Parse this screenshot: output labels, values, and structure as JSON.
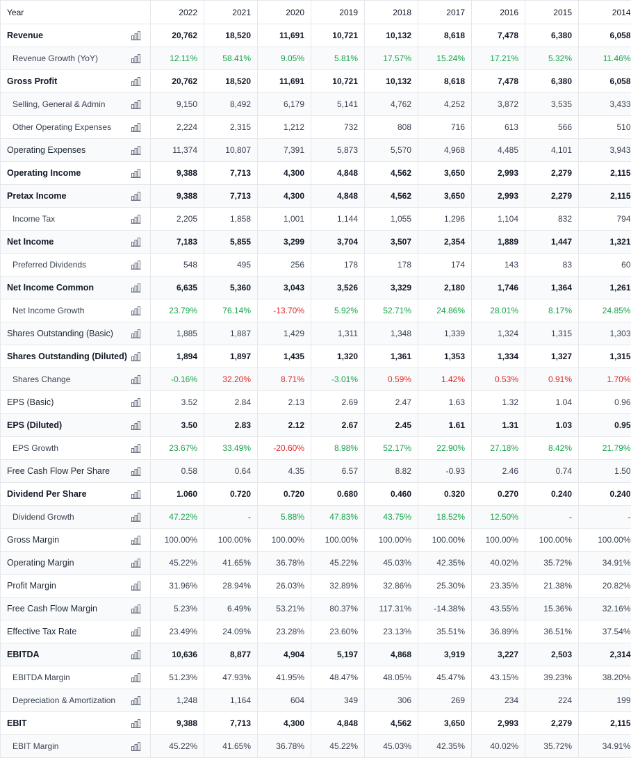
{
  "header": {
    "label": "Year",
    "years": [
      "2022",
      "2021",
      "2020",
      "2019",
      "2018",
      "2017",
      "2016",
      "2015",
      "2014"
    ]
  },
  "colors": {
    "positive": "#16a34a",
    "negative": "#dc2626",
    "icon": "#6b7280"
  },
  "rows": [
    {
      "label": "Revenue",
      "style": "bold",
      "icon": "bar-chart-icon",
      "values": [
        "20,762",
        "18,520",
        "11,691",
        "10,721",
        "10,132",
        "8,618",
        "7,478",
        "6,380",
        "6,058"
      ]
    },
    {
      "label": "Revenue Growth (YoY)",
      "style": "indent",
      "icon": "bar-chart-icon",
      "values": [
        "12.11%",
        "58.41%",
        "9.05%",
        "5.81%",
        "17.57%",
        "15.24%",
        "17.21%",
        "5.32%",
        "11.46%"
      ],
      "signs": [
        "pos",
        "pos",
        "pos",
        "pos",
        "pos",
        "pos",
        "pos",
        "pos",
        "pos"
      ]
    },
    {
      "label": "Gross Profit",
      "style": "bold",
      "icon": "bar-chart-icon",
      "values": [
        "20,762",
        "18,520",
        "11,691",
        "10,721",
        "10,132",
        "8,618",
        "7,478",
        "6,380",
        "6,058"
      ]
    },
    {
      "label": "Selling, General & Admin",
      "style": "indent",
      "icon": "bar-chart-icon",
      "values": [
        "9,150",
        "8,492",
        "6,179",
        "5,141",
        "4,762",
        "4,252",
        "3,872",
        "3,535",
        "3,433"
      ]
    },
    {
      "label": "Other Operating Expenses",
      "style": "indent",
      "icon": "bar-chart-icon",
      "values": [
        "2,224",
        "2,315",
        "1,212",
        "732",
        "808",
        "716",
        "613",
        "566",
        "510"
      ]
    },
    {
      "label": "Operating Expenses",
      "style": "normal",
      "icon": "bar-chart-icon",
      "values": [
        "11,374",
        "10,807",
        "7,391",
        "5,873",
        "5,570",
        "4,968",
        "4,485",
        "4,101",
        "3,943"
      ]
    },
    {
      "label": "Operating Income",
      "style": "bold",
      "icon": "bar-chart-icon",
      "values": [
        "9,388",
        "7,713",
        "4,300",
        "4,848",
        "4,562",
        "3,650",
        "2,993",
        "2,279",
        "2,115"
      ]
    },
    {
      "label": "Pretax Income",
      "style": "bold",
      "icon": "bar-chart-icon",
      "values": [
        "9,388",
        "7,713",
        "4,300",
        "4,848",
        "4,562",
        "3,650",
        "2,993",
        "2,279",
        "2,115"
      ]
    },
    {
      "label": "Income Tax",
      "style": "indent",
      "icon": "bar-chart-icon",
      "values": [
        "2,205",
        "1,858",
        "1,001",
        "1,144",
        "1,055",
        "1,296",
        "1,104",
        "832",
        "794"
      ]
    },
    {
      "label": "Net Income",
      "style": "bold",
      "icon": "bar-chart-icon",
      "values": [
        "7,183",
        "5,855",
        "3,299",
        "3,704",
        "3,507",
        "2,354",
        "1,889",
        "1,447",
        "1,321"
      ]
    },
    {
      "label": "Preferred Dividends",
      "style": "indent",
      "icon": "bar-chart-icon",
      "values": [
        "548",
        "495",
        "256",
        "178",
        "178",
        "174",
        "143",
        "83",
        "60"
      ]
    },
    {
      "label": "Net Income Common",
      "style": "bold",
      "icon": "bar-chart-icon",
      "values": [
        "6,635",
        "5,360",
        "3,043",
        "3,526",
        "3,329",
        "2,180",
        "1,746",
        "1,364",
        "1,261"
      ]
    },
    {
      "label": "Net Income Growth",
      "style": "indent",
      "icon": "bar-chart-icon",
      "values": [
        "23.79%",
        "76.14%",
        "-13.70%",
        "5.92%",
        "52.71%",
        "24.86%",
        "28.01%",
        "8.17%",
        "24.85%"
      ],
      "signs": [
        "pos",
        "pos",
        "neg",
        "pos",
        "pos",
        "pos",
        "pos",
        "pos",
        "pos"
      ]
    },
    {
      "label": "Shares Outstanding (Basic)",
      "style": "normal",
      "icon": "bar-chart-icon",
      "values": [
        "1,885",
        "1,887",
        "1,429",
        "1,311",
        "1,348",
        "1,339",
        "1,324",
        "1,315",
        "1,303"
      ]
    },
    {
      "label": "Shares Outstanding (Diluted)",
      "style": "bold",
      "icon": "bar-chart-icon",
      "values": [
        "1,894",
        "1,897",
        "1,435",
        "1,320",
        "1,361",
        "1,353",
        "1,334",
        "1,327",
        "1,315"
      ]
    },
    {
      "label": "Shares Change",
      "style": "indent",
      "icon": "bar-chart-icon",
      "values": [
        "-0.16%",
        "32.20%",
        "8.71%",
        "-3.01%",
        "0.59%",
        "1.42%",
        "0.53%",
        "0.91%",
        "1.70%"
      ],
      "signs": [
        "pos",
        "neg",
        "neg",
        "pos",
        "neg",
        "neg",
        "neg",
        "neg",
        "neg"
      ]
    },
    {
      "label": "EPS (Basic)",
      "style": "normal",
      "icon": "bar-chart-icon",
      "values": [
        "3.52",
        "2.84",
        "2.13",
        "2.69",
        "2.47",
        "1.63",
        "1.32",
        "1.04",
        "0.96"
      ]
    },
    {
      "label": "EPS (Diluted)",
      "style": "bold",
      "icon": "bar-chart-icon",
      "values": [
        "3.50",
        "2.83",
        "2.12",
        "2.67",
        "2.45",
        "1.61",
        "1.31",
        "1.03",
        "0.95"
      ]
    },
    {
      "label": "EPS Growth",
      "style": "indent",
      "icon": "bar-chart-icon",
      "values": [
        "23.67%",
        "33.49%",
        "-20.60%",
        "8.98%",
        "52.17%",
        "22.90%",
        "27.18%",
        "8.42%",
        "21.79%"
      ],
      "signs": [
        "pos",
        "pos",
        "neg",
        "pos",
        "pos",
        "pos",
        "pos",
        "pos",
        "pos"
      ]
    },
    {
      "label": "Free Cash Flow Per Share",
      "style": "normal",
      "icon": "bar-chart-icon",
      "values": [
        "0.58",
        "0.64",
        "4.35",
        "6.57",
        "8.82",
        "-0.93",
        "2.46",
        "0.74",
        "1.50"
      ]
    },
    {
      "label": "Dividend Per Share",
      "style": "bold",
      "icon": "bar-chart-icon",
      "values": [
        "1.060",
        "0.720",
        "0.720",
        "0.680",
        "0.460",
        "0.320",
        "0.270",
        "0.240",
        "0.240"
      ]
    },
    {
      "label": "Dividend Growth",
      "style": "indent",
      "icon": "bar-chart-icon",
      "values": [
        "47.22%",
        "-",
        "5.88%",
        "47.83%",
        "43.75%",
        "18.52%",
        "12.50%",
        "-",
        "-"
      ],
      "signs": [
        "pos",
        "neu",
        "pos",
        "pos",
        "pos",
        "pos",
        "pos",
        "neu",
        "neu"
      ]
    },
    {
      "label": "Gross Margin",
      "style": "normal",
      "icon": "bar-chart-icon",
      "values": [
        "100.00%",
        "100.00%",
        "100.00%",
        "100.00%",
        "100.00%",
        "100.00%",
        "100.00%",
        "100.00%",
        "100.00%"
      ]
    },
    {
      "label": "Operating Margin",
      "style": "normal",
      "icon": "bar-chart-icon",
      "values": [
        "45.22%",
        "41.65%",
        "36.78%",
        "45.22%",
        "45.03%",
        "42.35%",
        "40.02%",
        "35.72%",
        "34.91%"
      ]
    },
    {
      "label": "Profit Margin",
      "style": "normal",
      "icon": "bar-chart-icon",
      "values": [
        "31.96%",
        "28.94%",
        "26.03%",
        "32.89%",
        "32.86%",
        "25.30%",
        "23.35%",
        "21.38%",
        "20.82%"
      ]
    },
    {
      "label": "Free Cash Flow Margin",
      "style": "normal",
      "icon": "bar-chart-icon",
      "values": [
        "5.23%",
        "6.49%",
        "53.21%",
        "80.37%",
        "117.31%",
        "-14.38%",
        "43.55%",
        "15.36%",
        "32.16%"
      ]
    },
    {
      "label": "Effective Tax Rate",
      "style": "normal",
      "icon": "bar-chart-icon",
      "values": [
        "23.49%",
        "24.09%",
        "23.28%",
        "23.60%",
        "23.13%",
        "35.51%",
        "36.89%",
        "36.51%",
        "37.54%"
      ]
    },
    {
      "label": "EBITDA",
      "style": "bold",
      "icon": "bar-chart-icon",
      "values": [
        "10,636",
        "8,877",
        "4,904",
        "5,197",
        "4,868",
        "3,919",
        "3,227",
        "2,503",
        "2,314"
      ]
    },
    {
      "label": "EBITDA Margin",
      "style": "indent",
      "icon": "bar-chart-icon",
      "values": [
        "51.23%",
        "47.93%",
        "41.95%",
        "48.47%",
        "48.05%",
        "45.47%",
        "43.15%",
        "39.23%",
        "38.20%"
      ]
    },
    {
      "label": "Depreciation & Amortization",
      "style": "indent",
      "icon": "bar-chart-icon",
      "values": [
        "1,248",
        "1,164",
        "604",
        "349",
        "306",
        "269",
        "234",
        "224",
        "199"
      ]
    },
    {
      "label": "EBIT",
      "style": "bold",
      "icon": "bar-chart-icon",
      "values": [
        "9,388",
        "7,713",
        "4,300",
        "4,848",
        "4,562",
        "3,650",
        "2,993",
        "2,279",
        "2,115"
      ]
    },
    {
      "label": "EBIT Margin",
      "style": "indent",
      "icon": "bar-chart-icon",
      "values": [
        "45.22%",
        "41.65%",
        "36.78%",
        "45.22%",
        "45.03%",
        "42.35%",
        "40.02%",
        "35.72%",
        "34.91%"
      ]
    }
  ]
}
